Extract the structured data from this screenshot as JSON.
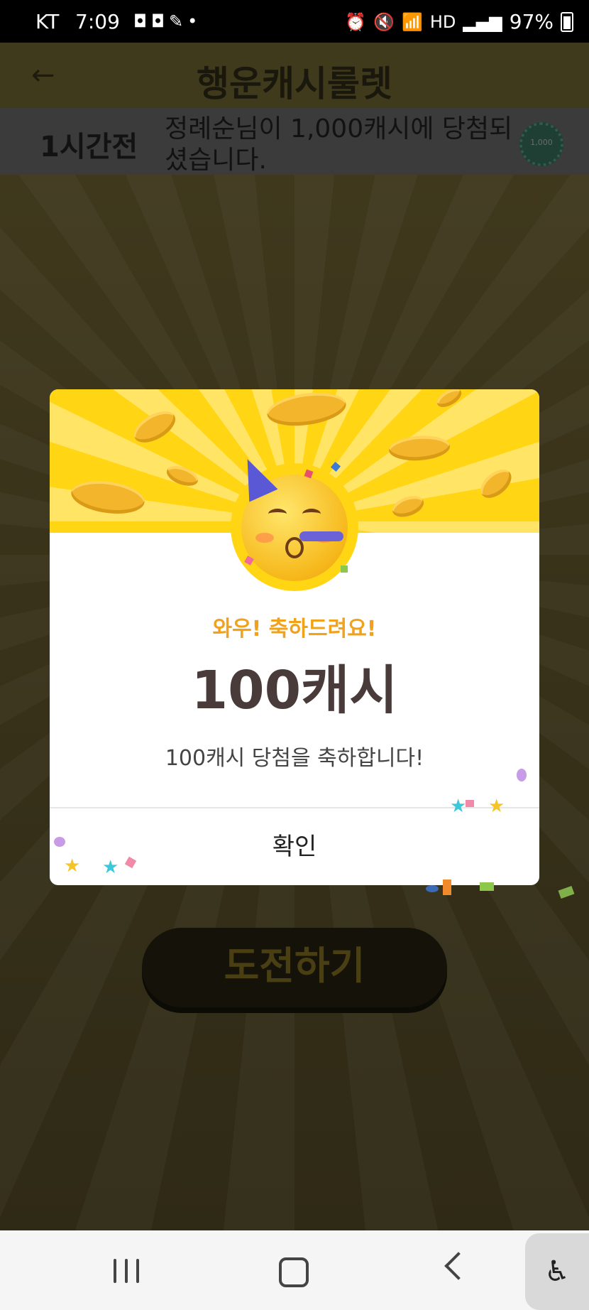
{
  "status_bar": {
    "carrier": "KT",
    "time": "7:09",
    "left_icons": [
      "app-notification-icon",
      "app-notification-icon",
      "feather-icon",
      "dot-icon"
    ],
    "right_icons": [
      "alarm-icon",
      "mute-icon",
      "wifi-icon",
      "hd-icon",
      "signal-icon"
    ],
    "battery": "97%"
  },
  "app_bar": {
    "title": "행운캐시룰렛",
    "back_icon": "arrow-left-icon"
  },
  "ticker": {
    "time": "1시간전",
    "message": "정례순님이 1,000캐시에 당첨되셨습니다.",
    "badge": "1,000"
  },
  "game": {
    "challenge_label": "도전하기"
  },
  "modal": {
    "congrats": "와우! 축하드려요!",
    "amount": "100캐시",
    "description": "100캐시 당첨을 축하합니다!",
    "confirm_label": "확인",
    "emoji": "party-face-icon"
  },
  "nav_bar": {
    "icons": [
      "recents-icon",
      "home-icon",
      "back-icon"
    ],
    "accessibility_icon": "accessibility-icon"
  },
  "colors": {
    "banner_yellow": "#ffd514",
    "congrats_orange": "#f1a21a",
    "amount_text": "#4a3b3b"
  }
}
